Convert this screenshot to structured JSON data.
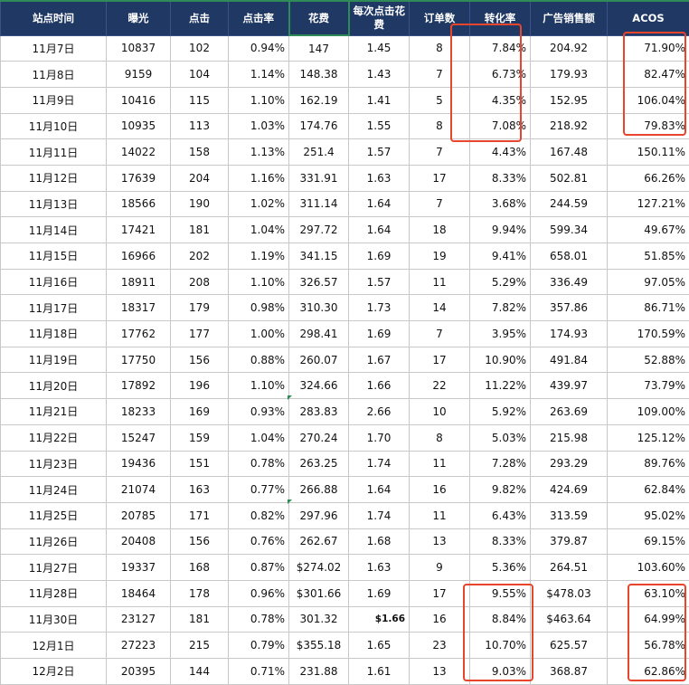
{
  "headers": [
    "站点时间",
    "曝光",
    "点击",
    "点击率",
    "花费",
    "每次点击花费",
    "订单数",
    "转化率",
    "广告销售额",
    "ACOS"
  ],
  "rows": [
    [
      "11月7日",
      "10837",
      "102",
      "0.94%",
      "147",
      "1.45",
      "8",
      "7.84%",
      "204.92",
      "71.90%"
    ],
    [
      "11月8日",
      "9159",
      "104",
      "1.14%",
      "148.38",
      "1.43",
      "7",
      "6.73%",
      "179.93",
      "82.47%"
    ],
    [
      "11月9日",
      "10416",
      "115",
      "1.10%",
      "162.19",
      "1.41",
      "5",
      "4.35%",
      "152.95",
      "106.04%"
    ],
    [
      "11月10日",
      "10935",
      "113",
      "1.03%",
      "174.76",
      "1.55",
      "8",
      "7.08%",
      "218.92",
      "79.83%"
    ],
    [
      "11月11日",
      "14022",
      "158",
      "1.13%",
      "251.4",
      "1.57",
      "7",
      "4.43%",
      "167.48",
      "150.11%"
    ],
    [
      "11月12日",
      "17639",
      "204",
      "1.16%",
      "331.91",
      "1.63",
      "17",
      "8.33%",
      "502.81",
      "66.26%"
    ],
    [
      "11月13日",
      "18566",
      "190",
      "1.02%",
      "311.14",
      "1.64",
      "7",
      "3.68%",
      "244.59",
      "127.21%"
    ],
    [
      "11月14日",
      "17421",
      "181",
      "1.04%",
      "297.72",
      "1.64",
      "18",
      "9.94%",
      "599.34",
      "49.67%"
    ],
    [
      "11月15日",
      "16966",
      "202",
      "1.19%",
      "341.15",
      "1.69",
      "19",
      "9.41%",
      "658.01",
      "51.85%"
    ],
    [
      "11月16日",
      "18911",
      "208",
      "1.10%",
      "326.57",
      "1.57",
      "11",
      "5.29%",
      "336.49",
      "97.05%"
    ],
    [
      "11月17日",
      "18317",
      "179",
      "0.98%",
      "310.30",
      "1.73",
      "14",
      "7.82%",
      "357.86",
      "86.71%"
    ],
    [
      "11月18日",
      "17762",
      "177",
      "1.00%",
      "298.41",
      "1.69",
      "7",
      "3.95%",
      "174.93",
      "170.59%"
    ],
    [
      "11月19日",
      "17750",
      "156",
      "0.88%",
      "260.07",
      "1.67",
      "17",
      "10.90%",
      "491.84",
      "52.88%"
    ],
    [
      "11月20日",
      "17892",
      "196",
      "1.10%",
      "324.66",
      "1.66",
      "22",
      "11.22%",
      "439.97",
      "73.79%"
    ],
    [
      "11月21日",
      "18233",
      "169",
      "0.93%",
      "283.83",
      "2.66",
      "10",
      "5.92%",
      "263.69",
      "109.00%"
    ],
    [
      "11月22日",
      "15247",
      "159",
      "1.04%",
      "270.24",
      "1.70",
      "8",
      "5.03%",
      "215.98",
      "125.12%"
    ],
    [
      "11月23日",
      "19436",
      "151",
      "0.78%",
      "263.25",
      "1.74",
      "11",
      "7.28%",
      "293.29",
      "89.76%"
    ],
    [
      "11月24日",
      "21074",
      "163",
      "0.77%",
      "266.88",
      "1.64",
      "16",
      "9.82%",
      "424.69",
      "62.84%"
    ],
    [
      "11月25日",
      "20785",
      "171",
      "0.82%",
      "297.96",
      "1.74",
      "11",
      "6.43%",
      "313.59",
      "95.02%"
    ],
    [
      "11月26日",
      "20408",
      "156",
      "0.76%",
      "262.67",
      "1.68",
      "13",
      "8.33%",
      "379.87",
      "69.15%"
    ],
    [
      "11月27日",
      "19337",
      "168",
      "0.87%",
      "$274.02",
      "1.63",
      "9",
      "5.36%",
      "264.51",
      "103.60%"
    ],
    [
      "11月28日",
      "18464",
      "178",
      "0.96%",
      "$301.66",
      "1.69",
      "17",
      "9.55%",
      "$478.03",
      "63.10%"
    ],
    [
      "11月30日",
      "23127",
      "181",
      "0.78%",
      "301.32",
      "$1.66",
      "16",
      "8.84%",
      "$463.64",
      "64.99%"
    ],
    [
      "12月1日",
      "27223",
      "215",
      "0.79%",
      "$355.18",
      "1.65",
      "23",
      "10.70%",
      "625.57",
      "56.78%"
    ],
    [
      "12月2日",
      "20395",
      "144",
      "0.71%",
      "231.88",
      "1.61",
      "13",
      "9.03%",
      "368.87",
      "62.86%"
    ]
  ],
  "colors": {
    "header_bg": "#1f3864",
    "highlight": "#e8452c",
    "selection": "#2e8b57"
  }
}
